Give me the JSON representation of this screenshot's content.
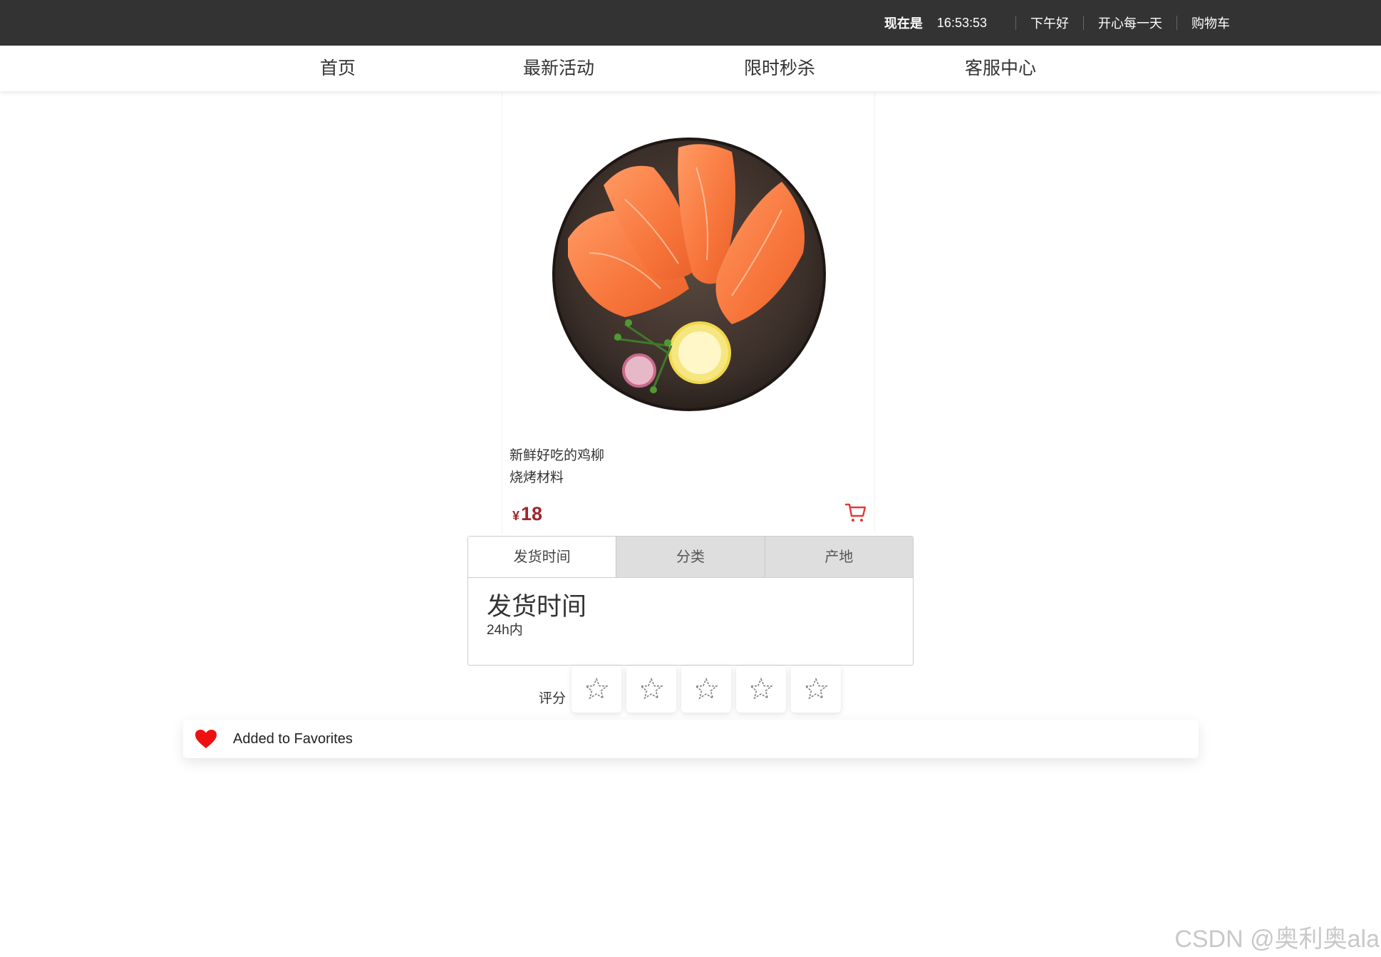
{
  "topbar": {
    "greeting_label": "现在是",
    "time": "16:53:53",
    "links": [
      "下午好",
      "开心每一天",
      "购物车"
    ]
  },
  "nav": {
    "items": [
      "首页",
      "最新活动",
      "限时秒杀",
      "客服中心"
    ]
  },
  "product": {
    "image_icon": "salmon-plate-image",
    "name_line1": "新鲜好吃的鸡柳",
    "name_line2": "烧烤材料",
    "currency": "¥",
    "price": "18",
    "cart_icon": "shopping-cart-icon",
    "accent_color": "#a0262b"
  },
  "tabs": {
    "labels": [
      "发货时间",
      "分类",
      "产地"
    ],
    "active_index": 0,
    "content_title": "发货时间",
    "content_text": "24h内"
  },
  "rating": {
    "label": "评分",
    "max": 5,
    "value": 0
  },
  "toast": {
    "icon": "heart-icon",
    "message": "Added to Favorites",
    "icon_color": "#ee1111"
  },
  "watermark": "CSDN @奥利奥ala"
}
